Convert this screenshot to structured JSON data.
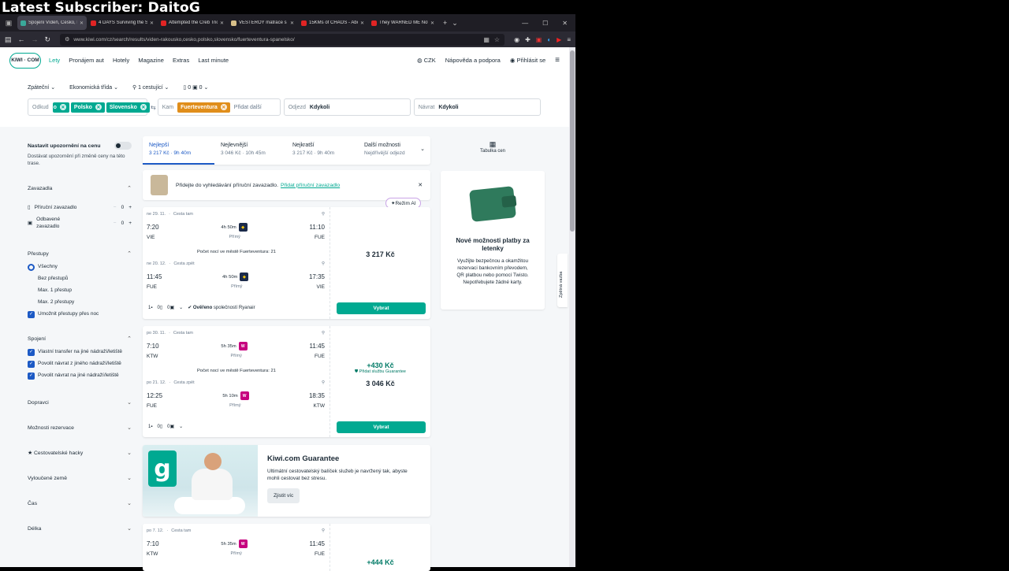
{
  "overlay": {
    "text": "Latest Subscriber: DaitoG"
  },
  "browser": {
    "tabs": [
      {
        "title": "Spojení Vídeň, Česko, P",
        "color": "#3aa89a",
        "active": true
      },
      {
        "title": "4 DAYS Surviving the SV",
        "color": "#e02424"
      },
      {
        "title": "Attempted the Creb Trio",
        "color": "#e02424"
      },
      {
        "title": "VESTERÖY matrace s taš",
        "color": "#d8c08a"
      },
      {
        "title": "15KMs of CHAOS - Abo",
        "color": "#e02424"
      },
      {
        "title": "They WARNED ME Not",
        "color": "#e02424"
      }
    ],
    "url": "www.kiwi.com/cz/search/results/viden-rakousko,cesko,polsko,slovensko/fuerteventura-spanelsko/"
  },
  "header": {
    "logo": "KIWI · COM",
    "nav": [
      "Lety",
      "Pronájem aut",
      "Hotely",
      "Magazine",
      "Extras",
      "Last minute"
    ],
    "currency": "CZK",
    "help": "Nápověda a podpora",
    "login": "Přihlásit se"
  },
  "search": {
    "trip_type": "Zpáteční",
    "cabin": "Ekonomická třída",
    "passengers": "1 cestující",
    "bags1": "0",
    "bags2": "0",
    "from_label": "Odkud",
    "from_chips": [
      "o",
      "Polsko",
      "Slovensko"
    ],
    "to_label": "Kam",
    "to_chip": "Fuerteventura",
    "add_more": "Přidat další",
    "depart_label": "Odjezd",
    "depart_value": "Kdykoli",
    "return_label": "Návrat",
    "return_value": "Kdykoli"
  },
  "sidebar": {
    "alert_title": "Nastavit upozornění na cenu",
    "alert_desc": "Dostávat upozornění při změně ceny na této trase.",
    "bags_title": "Zavazadla",
    "cabin_bag": "Příruční zavazadlo",
    "cabin_count": "0",
    "checked_bag": "Odbavené zavazadlo",
    "checked_count": "0",
    "stops_title": "Přestupy",
    "stops": [
      "Všechny",
      "Bez přestupů",
      "Max. 1 přestup",
      "Max. 2 přestupy"
    ],
    "overnight": "Umožnit přestupy přes noc",
    "conn_title": "Spojení",
    "conn": [
      "Vlastní transfer na jiné nádraží/letiště",
      "Povolit návrat z jiného nádraží/letiště",
      "Povolit návrat na jiné nádraží/letiště"
    ],
    "carriers": "Dopravci",
    "booking": "Možnosti rezervace",
    "hacks": "Cestovatelské hacky",
    "excluded": "Vyloučené země",
    "time": "Čas",
    "length": "Délka"
  },
  "sort": [
    {
      "title": "Nejlepší",
      "sub": "3 217 Kč · 9h 40m"
    },
    {
      "title": "Nejlevnější",
      "sub": "3 046 Kč · 10h 45m"
    },
    {
      "title": "Nejkratší",
      "sub": "3 217 Kč · 9h 40m"
    },
    {
      "title": "Další možnosti",
      "sub": "Nejdřívější odjezd"
    }
  ],
  "bag_banner": {
    "text": "Přidejte do vyhledávání příruční zavazadlo.",
    "link": "Přidat příruční zavazadlo"
  },
  "ai_mode": "Režim AI",
  "results": [
    {
      "out": {
        "date": "ne 29. 11.",
        "dir": "Cesta tam",
        "dep": "7:20",
        "dur": "4h 50m",
        "arr": "11:10",
        "from": "VIE",
        "stops": "Přímý",
        "to": "FUE"
      },
      "nights": "Počet nocí ve městě Fuerteventura: 21",
      "ret": {
        "date": "ne 20. 12.",
        "dir": "Cesta zpět",
        "dep": "11:45",
        "dur": "4h 50m",
        "arr": "17:35",
        "from": "FUE",
        "stops": "Přímý",
        "to": "VIE"
      },
      "bags": [
        "1",
        "0",
        "0"
      ],
      "verified": "Ověřeno",
      "verified_by": "společností Ryanair",
      "price": "3 217 Kč",
      "select": "Vybrat"
    },
    {
      "out": {
        "date": "po 30. 11.",
        "dir": "Cesta tam",
        "dep": "7:10",
        "dur": "5h 35m",
        "arr": "11:45",
        "from": "KTW",
        "stops": "Přímý",
        "to": "FUE"
      },
      "nights": "Počet nocí ve městě Fuerteventura: 21",
      "ret": {
        "date": "po 21. 12.",
        "dir": "Cesta zpět",
        "dep": "12:25",
        "dur": "5h 10m",
        "arr": "18:35",
        "from": "FUE",
        "stops": "Přímý",
        "to": "KTW"
      },
      "bags": [
        "1",
        "0",
        "0"
      ],
      "guarantee_price": "+430 Kč",
      "guarantee_label": "Přidat službu Guarantee",
      "price": "3 046 Kč",
      "select": "Vybrat"
    },
    {
      "out": {
        "date": "po 7. 12.",
        "dir": "Cesta tam",
        "dep": "7:10",
        "dur": "5h 35m",
        "arr": "11:45",
        "from": "KTW",
        "stops": "Přímý",
        "to": "FUE"
      },
      "guarantee_price": "+444 Kč"
    }
  ],
  "guarantee": {
    "logo": "g",
    "title": "Kiwi.com Guarantee",
    "text": "Ultimátní cestovatelský balíček služeb je navržený tak, abyste mohli cestovat bez stresu.",
    "button": "Zjistit víc"
  },
  "right": {
    "price_table": "Tabulka cen",
    "promo_title": "Nové možnosti platby za letenky",
    "promo_text": "Využijte bezpečnou a okamžitou rezervaci bankovním převodem, QR platbou nebo pomocí Twisto. Nepotřebujete žádné karty.",
    "feedback": "Zpětná vazba"
  }
}
